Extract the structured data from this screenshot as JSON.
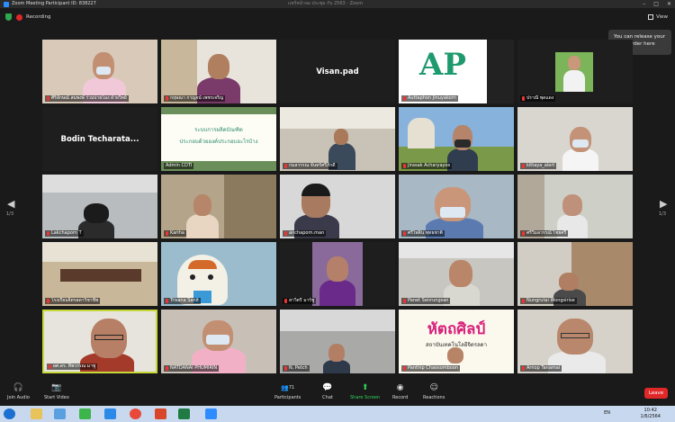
{
  "window": {
    "title": "Zoom Meeting Participant ID: 838227",
    "center_text": "แชร์หน้าจอ ประชุม กับ 2563 - Zoom"
  },
  "topbar": {
    "recording_label": "Recording",
    "view_label": "View"
  },
  "tooltip": {
    "text": "You can release your video order here"
  },
  "pager": {
    "left": "1/3",
    "right": "1/3"
  },
  "tiles": [
    {
      "name": "ศิริลักษณ์ สมพงษ์ ร่วมบ่ายโมง ฝ่ายวิทย์"
    },
    {
      "name": "กฤษณา กาญจน์ เพชรเจริญ"
    },
    {
      "name": "Visan.pad",
      "display": "Visan.pad"
    },
    {
      "name": "Auttaphon Jinuyakorn",
      "display": "AP"
    },
    {
      "name": "ปราณี พุดแดง"
    },
    {
      "name": "Bodin Techarata...",
      "display": "Bodin Techarata..."
    },
    {
      "name": "Admin CDTI",
      "slide_line1": "ระบบการผลิตบัณฑิต",
      "slide_line2": "ประกอบด้วยองค์ประกอบอะไรบ้าง"
    },
    {
      "name": "กมลวรรณ จันทร์ศรีภักดี"
    },
    {
      "name": "Jirasak Acharyayos"
    },
    {
      "name": "kittaya_alert"
    },
    {
      "name": "Lakchaporn T"
    },
    {
      "name": "Kariha"
    },
    {
      "name": "anchaporn.man"
    },
    {
      "name": "ศรีไพลิน พุทธชาติ"
    },
    {
      "name": "ศรีวิมลวรรณ์ ไชยศรี"
    },
    {
      "name": "โรงเรียนจิตรลดาวิชาชีพ"
    },
    {
      "name": "Trisana Sanit"
    },
    {
      "name": "สาวิตรี มาร์ชู"
    },
    {
      "name": "Panet Senrungsan"
    },
    {
      "name": "Nungrutai Wongsirise"
    },
    {
      "name": "ผศ.ดร. ทิพวรรณ มาชู"
    },
    {
      "name": "NATDANAI PHUMIRIN"
    },
    {
      "name": "N. Petch"
    },
    {
      "name": "Panthip Chaosomboon",
      "logo_line1": "หัตถศิลป์",
      "logo_line2": "สถาบันเทคโนโลยีจิตรลดา"
    },
    {
      "name": "Arnop Tanamai"
    }
  ],
  "controls": {
    "join_audio": "Join Audio",
    "start_video": "Start Video",
    "participants": "Participants",
    "participant_count": "71",
    "chat": "Chat",
    "share_screen": "Share Screen",
    "record": "Record",
    "reactions": "Reactions",
    "leave": "Leave"
  },
  "taskbar": {
    "lang": "EN",
    "time": "10:42",
    "date": "1/6/2564"
  },
  "colors": {
    "share_green": "#2fd25a",
    "leave_red": "#e02828",
    "active_speaker": "#c7d93a"
  }
}
